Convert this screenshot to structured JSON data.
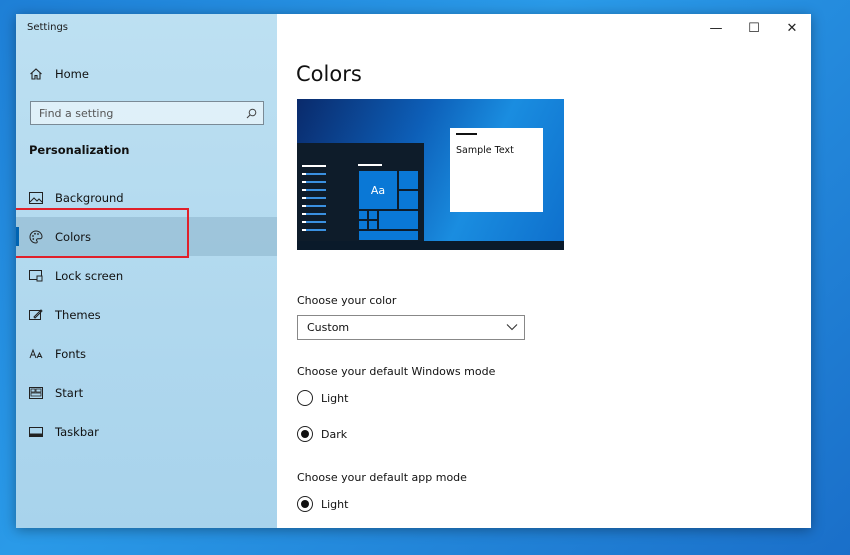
{
  "window": {
    "title": "Settings",
    "controls": {
      "minimize": "—",
      "maximize": "☐",
      "close": "✕"
    }
  },
  "sidebar": {
    "home_label": "Home",
    "search_placeholder": "Find a setting",
    "section_heading": "Personalization",
    "items": [
      {
        "label": "Background",
        "icon": "image-icon"
      },
      {
        "label": "Colors",
        "icon": "palette-icon",
        "active": true
      },
      {
        "label": "Lock screen",
        "icon": "lock-screen-icon"
      },
      {
        "label": "Themes",
        "icon": "themes-icon"
      },
      {
        "label": "Fonts",
        "icon": "fonts-icon"
      },
      {
        "label": "Start",
        "icon": "start-icon"
      },
      {
        "label": "Taskbar",
        "icon": "taskbar-icon"
      }
    ],
    "highlight_color": "#e0202a"
  },
  "main": {
    "title": "Colors",
    "preview": {
      "tile_text": "Aa",
      "sample_text": "Sample Text"
    },
    "choose_color_label": "Choose your color",
    "choose_color_value": "Custom",
    "windows_mode_label": "Choose your default Windows mode",
    "windows_mode_options": [
      "Light",
      "Dark"
    ],
    "windows_mode_selected": "Dark",
    "app_mode_label": "Choose your default app mode",
    "app_mode_options": [
      "Light"
    ],
    "app_mode_selected": "Light"
  },
  "colors": {
    "accent": "#0063b1",
    "sidebar_bg": "#b0d8ee",
    "desktop": "#1e7fd6"
  }
}
